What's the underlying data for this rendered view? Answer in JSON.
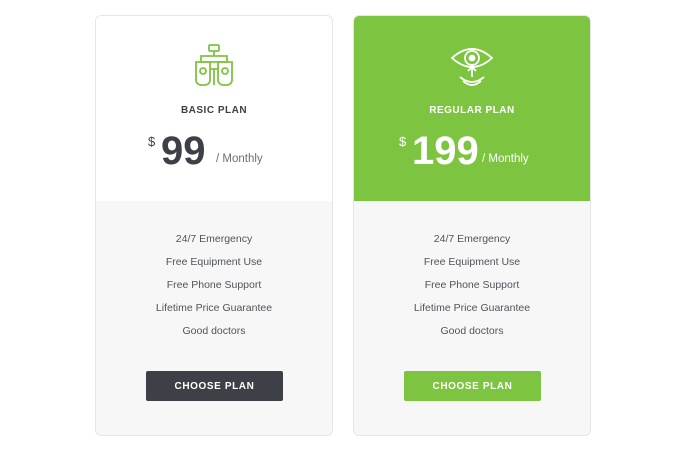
{
  "colors": {
    "accent_green": "#7dc540",
    "dark_button": "#3d4147",
    "card_bg": "#f7f7f7"
  },
  "plans": [
    {
      "icon": "optometry-equipment-icon",
      "name": "BASIC PLAN",
      "currency": "$",
      "amount": "99",
      "period": "/ Monthly",
      "features": [
        "24/7 Emergency",
        "Free Equipment Use",
        "Free Phone Support",
        "Lifetime Price Guarantee",
        "Good doctors"
      ],
      "button_label": "CHOOSE PLAN"
    },
    {
      "icon": "eye-contact-lens-icon",
      "name": "REGULAR PLAN",
      "currency": "$",
      "amount": "199",
      "period": "/ Monthly",
      "features": [
        "24/7 Emergency",
        "Free Equipment Use",
        "Free Phone Support",
        "Lifetime Price Guarantee",
        "Good doctors"
      ],
      "button_label": "CHOOSE PLAN"
    }
  ]
}
